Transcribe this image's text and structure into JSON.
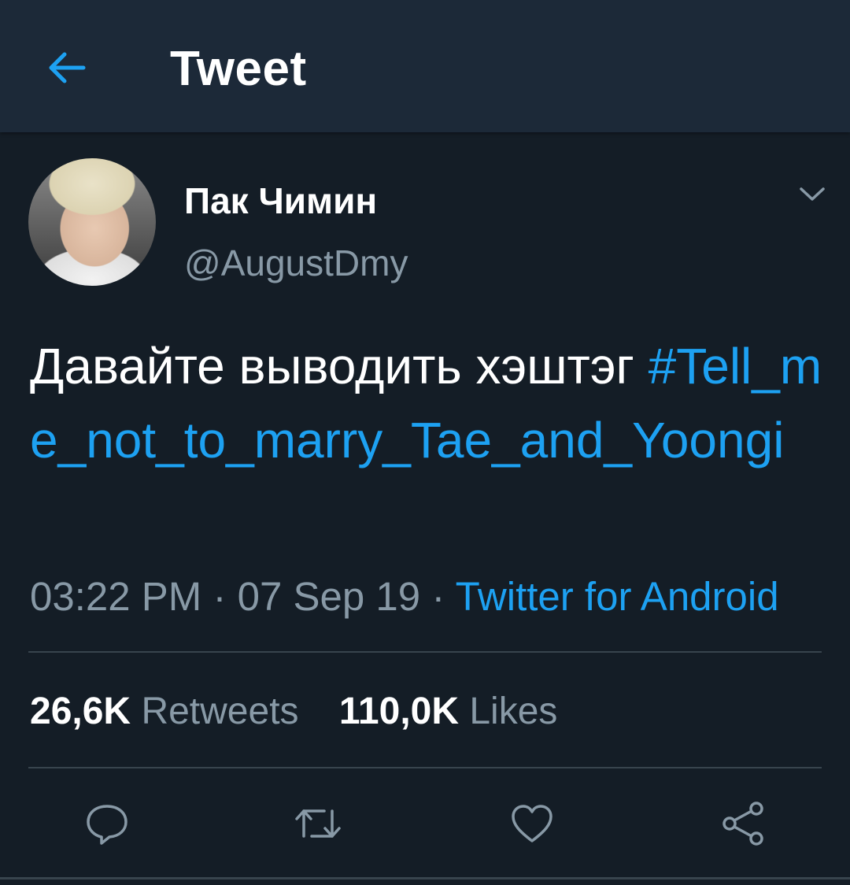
{
  "header": {
    "title": "Tweet",
    "back_icon": "arrow-left-icon"
  },
  "author": {
    "display_name": "Пак Чимин",
    "handle": "@AugustDmy"
  },
  "tweet": {
    "text": "Давайте выводить хэштэг ",
    "hashtag": "#Tell_me_not_to_marry_Tae_and_Yoongi"
  },
  "meta": {
    "time": "03:22 PM",
    "sep1": " · ",
    "date": "07 Sep 19",
    "sep2": " · ",
    "source": "Twitter for Android"
  },
  "stats": {
    "retweets_count": "26,6K",
    "retweets_label": "Retweets",
    "likes_count": "110,0K",
    "likes_label": "Likes"
  },
  "actions": [
    "reply-icon",
    "retweet-icon",
    "like-icon",
    "share-icon"
  ],
  "colors": {
    "background": "#141d26",
    "header": "#1c2938",
    "accent": "#1da1f2",
    "secondary_text": "#8899a6",
    "divider": "#38444d"
  }
}
